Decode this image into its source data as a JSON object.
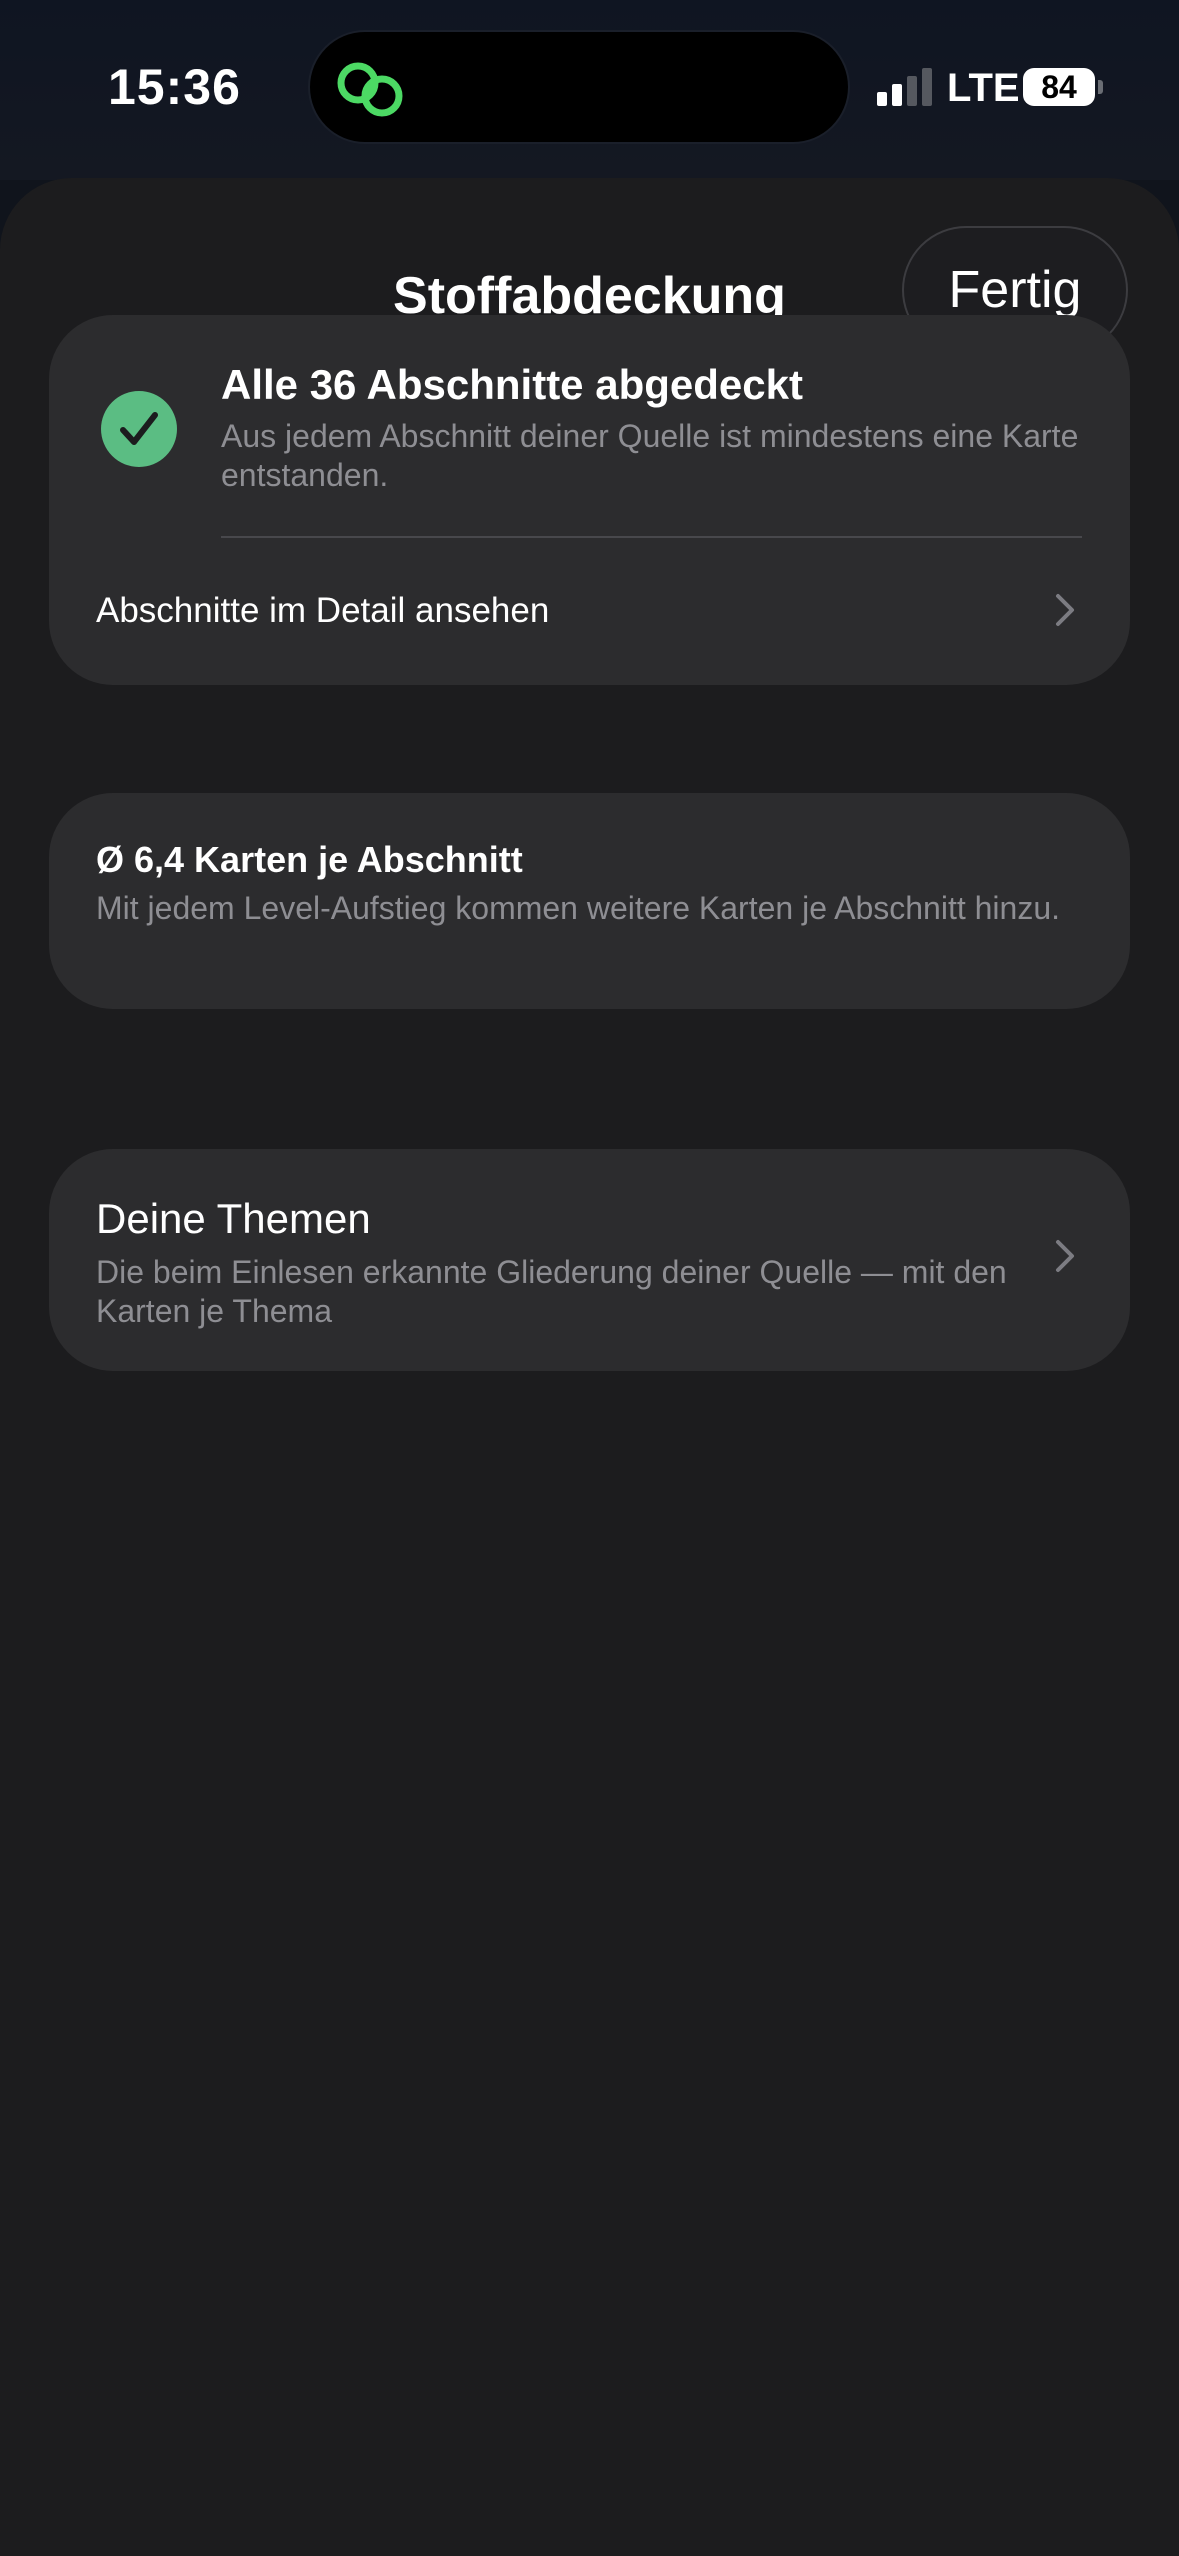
{
  "status_bar": {
    "time": "15:36",
    "network": "LTE",
    "battery": "84",
    "island_icon": "link-rings-icon",
    "island_icon_color": "#4cd964"
  },
  "sheet": {
    "title": "Stoffabdeckung",
    "done_label": "Fertig"
  },
  "coverage_card": {
    "icon": "checkmark-circle-icon",
    "icon_color": "#5bbd83",
    "title": "Alle 36 Abschnitte abgedeckt",
    "description": "Aus jedem Abschnitt deiner Quelle ist mindestens eine Karte entstanden.",
    "link_label": "Abschnitte im Detail ansehen"
  },
  "average_card": {
    "title": "Ø 6,4 Karten je Abschnitt",
    "description": "Mit jedem Level-Aufstieg kommen weitere Karten je Abschnitt hinzu."
  },
  "topics_card": {
    "title": "Deine Themen",
    "description": "Die beim Einlesen erkannte Gliederung deiner Quelle — mit den Karten je Thema"
  },
  "colors": {
    "background": "#1c1c1e",
    "card": "#2c2c2e",
    "secondary_text": "#8e8e93"
  }
}
